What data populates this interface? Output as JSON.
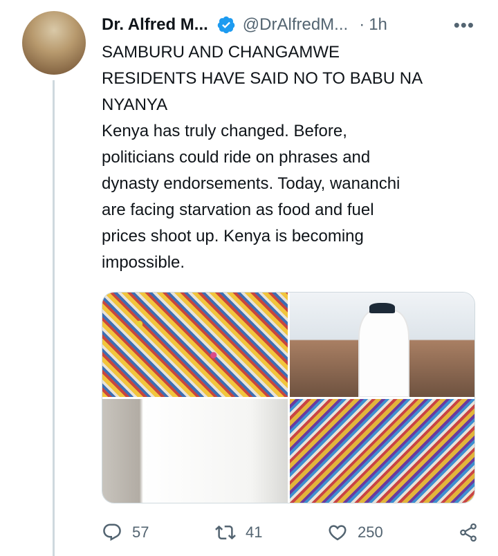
{
  "tweet": {
    "author_name": "Dr. Alfred M...",
    "handle": "@DrAlfredM...",
    "separator": "·",
    "time": "1h",
    "more": "•••",
    "lines": [
      "SAMBURU AND CHANGAMWE",
      "RESIDENTS HAVE SAID NO TO BABU NA",
      "NYANYA",
      "Kenya has truly changed. Before,",
      "politicians could ride on phrases and",
      "dynasty endorsements. Today, wananchi",
      "are facing starvation as food and fuel",
      "prices shoot up.  Kenya is becoming",
      "impossible."
    ]
  },
  "stats": {
    "replies": "57",
    "retweets": "41",
    "likes": "250"
  },
  "icons": {
    "verified": "verified-badge-icon",
    "reply": "reply-icon",
    "retweet": "retweet-icon",
    "like": "heart-icon",
    "share": "share-icon"
  },
  "colors": {
    "verified": "#1d9bf0",
    "secondary_text": "#536471",
    "thread_line": "#cfd9de"
  }
}
